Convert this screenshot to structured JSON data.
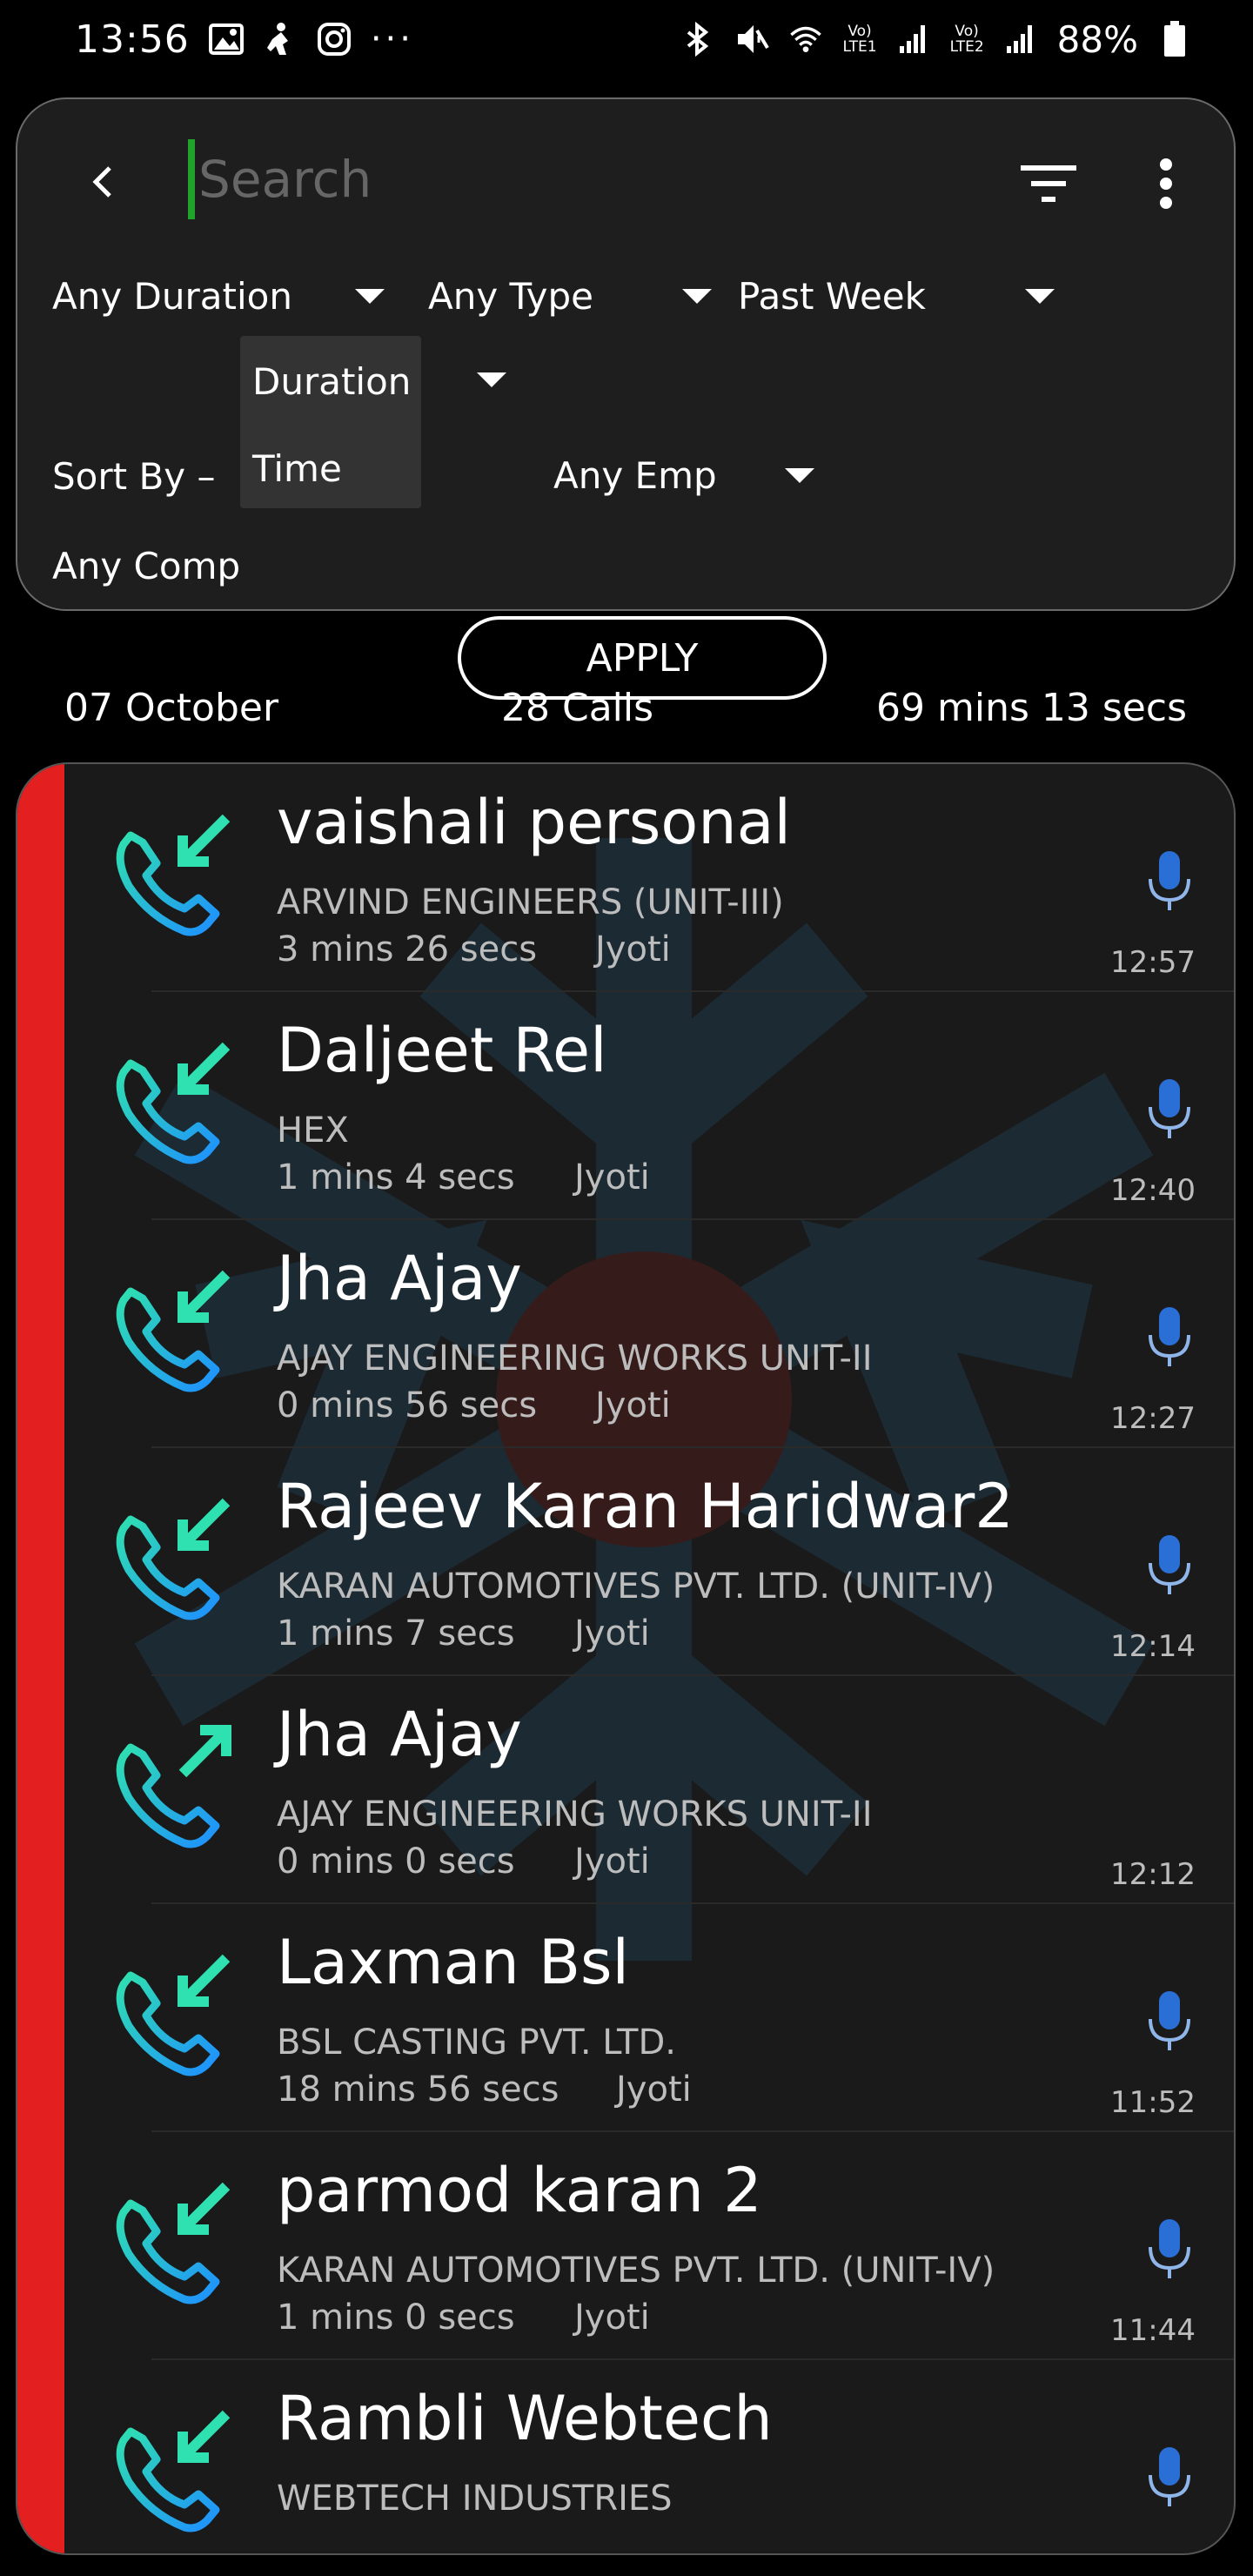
{
  "status_bar": {
    "time": "13:56",
    "battery": "88%",
    "sim1": [
      "Vo)",
      "LTE1"
    ],
    "sim2": [
      "Vo)",
      "LTE2"
    ],
    "left_icons": [
      "image-icon",
      "fitness-icon",
      "instagram-icon",
      "more-dots-icon"
    ],
    "right_icons": [
      "bluetooth-icon",
      "mute-icon",
      "wifi-icon",
      "signal-icon",
      "battery-icon"
    ]
  },
  "filters": {
    "search_placeholder": "Search",
    "duration": "Any Duration",
    "type": "Any Type",
    "period": "Past Week",
    "sort_label": "Sort By –",
    "sort_selected": "Duration",
    "sort_options": [
      "Duration",
      "Time"
    ],
    "employee": "Any Emp",
    "company": "Any Compa",
    "apply": "APPLY"
  },
  "summary": {
    "date": "07 October",
    "calls": "28 Calls",
    "total_duration": "69 mins 13 secs"
  },
  "calls": [
    {
      "name": "vaishali personal",
      "company": "ARVIND ENGINEERS (UNIT-III)",
      "duration": "3 mins 26 secs",
      "employee": "Jyoti",
      "time": "12:57",
      "direction": "incoming",
      "recording": true
    },
    {
      "name": "Daljeet Rel",
      "company": "HEX",
      "duration": "1 mins 4 secs",
      "employee": "Jyoti",
      "time": "12:40",
      "direction": "incoming",
      "recording": true
    },
    {
      "name": "Jha Ajay",
      "company": "AJAY ENGINEERING WORKS UNIT-II",
      "duration": "0 mins 56 secs",
      "employee": "Jyoti",
      "time": "12:27",
      "direction": "incoming",
      "recording": true
    },
    {
      "name": "Rajeev Karan Haridwar2",
      "company": "KARAN AUTOMOTIVES PVT. LTD. (UNIT-IV)",
      "duration": "1 mins 7 secs",
      "employee": "Jyoti",
      "time": "12:14",
      "direction": "incoming",
      "recording": true
    },
    {
      "name": "Jha Ajay",
      "company": "AJAY ENGINEERING WORKS UNIT-II",
      "duration": "0 mins 0 secs",
      "employee": "Jyoti",
      "time": "12:12",
      "direction": "outgoing",
      "recording": false
    },
    {
      "name": "Laxman Bsl",
      "company": "BSL CASTING PVT. LTD.",
      "duration": "18 mins 56 secs",
      "employee": "Jyoti",
      "time": "11:52",
      "direction": "incoming",
      "recording": true
    },
    {
      "name": "parmod karan 2",
      "company": "KARAN AUTOMOTIVES PVT. LTD. (UNIT-IV)",
      "duration": "1 mins 0 secs",
      "employee": "Jyoti",
      "time": "11:44",
      "direction": "incoming",
      "recording": true
    },
    {
      "name": "Rambli Webtech",
      "company": "WEBTECH INDUSTRIES",
      "duration": "",
      "employee": "",
      "time": "",
      "direction": "incoming",
      "recording": true
    }
  ],
  "colors": {
    "accent_red": "#e41f1f",
    "caret_green": "#1fa32a",
    "icon_teal": "#2fe0b0",
    "icon_blue": "#1e90ff",
    "mic_blue": "#2a6fd6"
  }
}
